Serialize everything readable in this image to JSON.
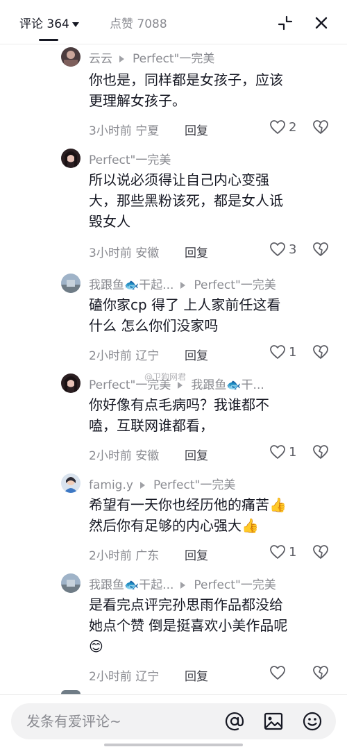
{
  "header": {
    "comments_tab": "评论 364",
    "likes_tab": "点赞 7088",
    "collapse_icon": "collapse-arrows-icon",
    "close_icon": "close-icon"
  },
  "watermark": "@卫狗网君",
  "comments": [
    {
      "user": "云云",
      "reply_to": "Perfect\"一完美",
      "lines": [
        "你也是，同样都是女孩子，应该",
        "更理解女孩子。"
      ],
      "time_location": "3小时前 宁夏",
      "reply_label": "回复",
      "likes": "2"
    },
    {
      "user": "Perfect\"一完美",
      "reply_to": "",
      "lines": [
        "所以说必须得让自己内心变强",
        "大，那些黑粉该死，都是女人诋",
        "毁女人"
      ],
      "time_location": "3小时前 安徽",
      "reply_label": "回复",
      "likes": "3"
    },
    {
      "user": "我跟鱼",
      "user_emoji": "🐟",
      "user_suffix": "干起...",
      "reply_to": "Perfect\"一完美",
      "lines": [
        "磕你家cp 得了 上人家前任这看",
        "什么 怎么你们没家吗"
      ],
      "time_location": "2小时前 辽宁",
      "reply_label": "回复",
      "likes": "1"
    },
    {
      "user": "Perfect\"一完美",
      "reply_to": "我跟鱼",
      "reply_to_emoji": "🐟",
      "reply_to_suffix": "干...",
      "lines": [
        "你好像有点毛病吗？我谁都不",
        "嗑，互联网谁都看，"
      ],
      "time_location": "2小时前 安徽",
      "reply_label": "回复",
      "likes": "1"
    },
    {
      "user": "famig.y",
      "reply_to": "Perfect\"一完美",
      "lines": [
        "希望有一天你也经历他的痛苦👍",
        "然后你有足够的内心强大👍"
      ],
      "time_location": "2小时前 广东",
      "reply_label": "回复",
      "likes": "1"
    },
    {
      "user": "我跟鱼",
      "user_emoji": "🐟",
      "user_suffix": "干起...",
      "reply_to": "Perfect\"一完美",
      "lines": [
        "是看完点评完孙思雨作品都没给",
        "她点个赞 倒是挺喜欢小美作品呢",
        "😊"
      ],
      "time_location": "2小时前 辽宁",
      "reply_label": "回复",
      "likes": ""
    }
  ],
  "bottom_bar": {
    "input_placeholder": "发条有爱评论~",
    "at_icon": "at-icon",
    "image_icon": "image-icon",
    "emoji_icon": "emoji-icon"
  }
}
